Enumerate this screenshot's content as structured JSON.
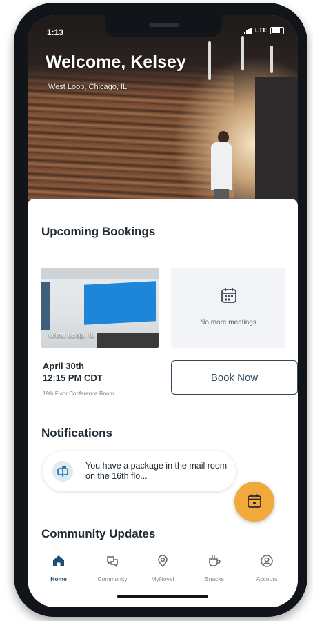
{
  "status_bar": {
    "time": "1:13",
    "network": "LTE"
  },
  "header": {
    "welcome": "Welcome, Kelsey",
    "location": "West Loop, Chicago, IL"
  },
  "bookings": {
    "title": "Upcoming Bookings",
    "photo_label": "West Loop, IL",
    "no_meetings": "No more meetings",
    "date": "April 30th",
    "time": "12:15 PM CDT",
    "room": "19th Floor Conference Room",
    "book_now": "Book Now"
  },
  "notifications": {
    "title": "Notifications",
    "items": [
      {
        "text": "You have a package in the mail room on the 16th flo..."
      }
    ]
  },
  "community": {
    "title": "Community Updates"
  },
  "tabs": [
    {
      "label": "Home",
      "icon": "home-icon",
      "active": true
    },
    {
      "label": "Community",
      "icon": "community-icon",
      "active": false
    },
    {
      "label": "MyNovel",
      "icon": "location-pin-icon",
      "active": false
    },
    {
      "label": "Snacks",
      "icon": "coffee-icon",
      "active": false
    },
    {
      "label": "Account",
      "icon": "account-icon",
      "active": false
    }
  ],
  "colors": {
    "accent": "#f2a93b",
    "primary": "#1b4e78",
    "button_border": "#2f4a5f"
  }
}
